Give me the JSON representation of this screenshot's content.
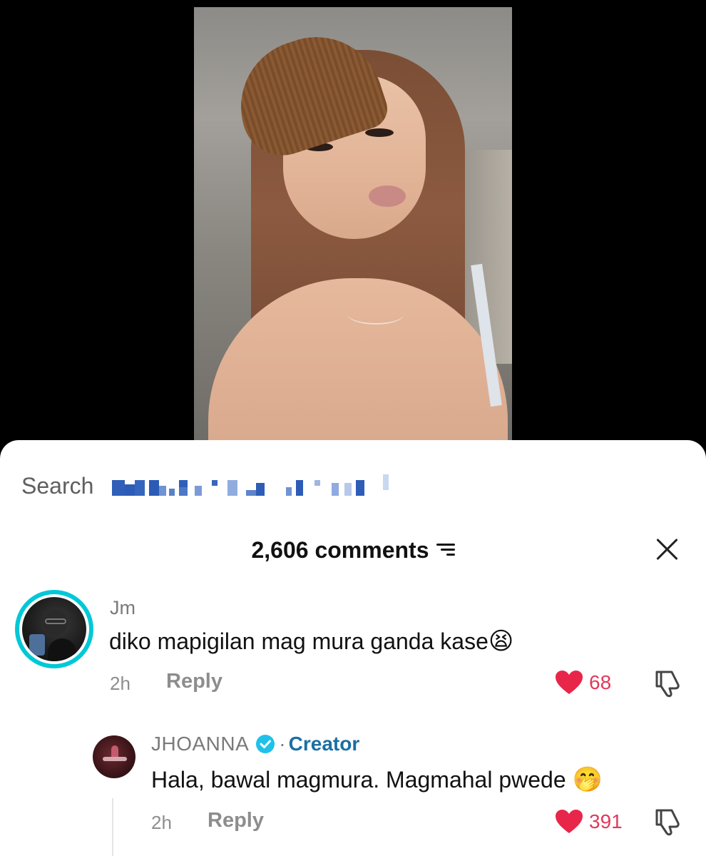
{
  "search": {
    "label": "Search"
  },
  "header": {
    "comments_count": "2,606 comments"
  },
  "comments": [
    {
      "username": "Jm",
      "text": "diko mapigilan mag mura ganda kase",
      "emoji": "😫",
      "time": "2h",
      "reply_label": "Reply",
      "likes": "68"
    }
  ],
  "reply": {
    "username": "JHOANNA",
    "badge": "Creator",
    "separator": "·",
    "text": "Hala, bawal magmura. Magmahal pwede",
    "emoji": "🤭",
    "time": "2h",
    "reply_label": "Reply",
    "likes": "391"
  },
  "colors": {
    "like": "#e03a5b",
    "creator": "#1b6fa3",
    "avatar_ring": "#00c8d7",
    "verified": "#20c1e8"
  }
}
